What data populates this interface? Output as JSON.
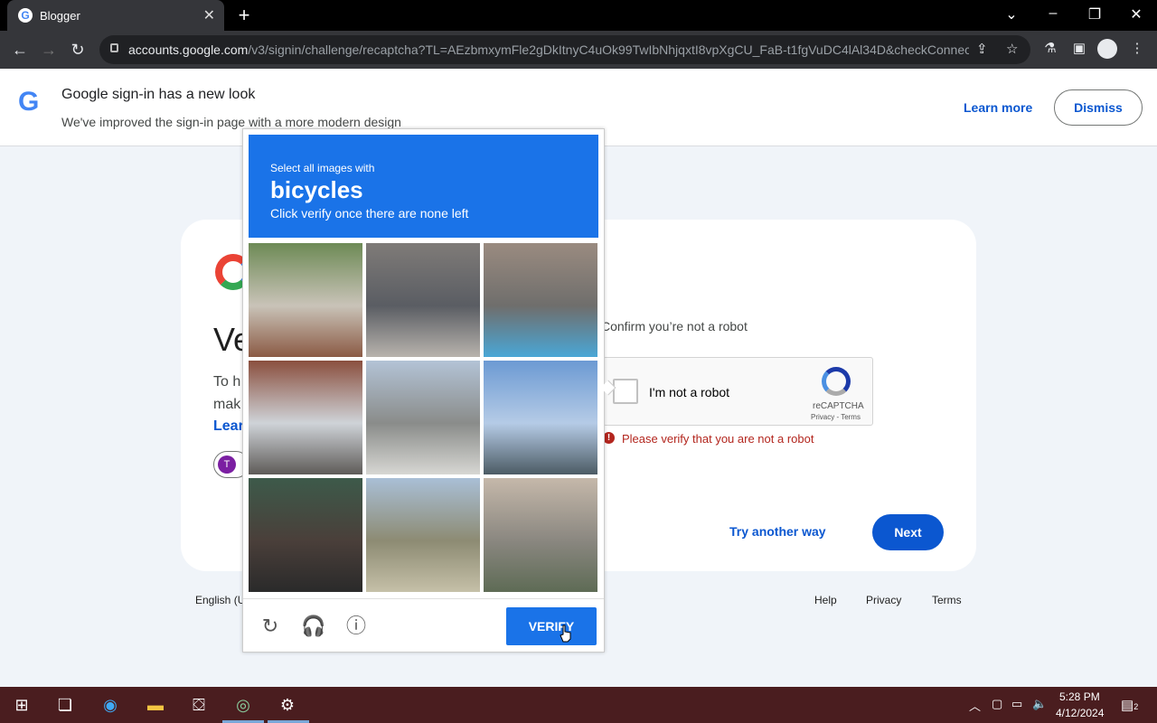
{
  "browser": {
    "tab_title": "Blogger",
    "tab_favicon": "G",
    "url_host": "accounts.google.com",
    "url_path": "/v3/signin/challenge/recaptcha?TL=AEzbmxymFle2gDkItnyC4uOk99TwIbNhjqxtI8vpXgCU_FaB-t1fgVuDC4lAl34D&checkConnec..."
  },
  "banner": {
    "logo": "G",
    "title": "Google sign-in has a new look",
    "subtitle": "We've improved the sign-in page with a more modern design",
    "learn_more": "Learn more",
    "dismiss": "Dismiss"
  },
  "card": {
    "heading_partial": "Ve",
    "line1_partial": "To h",
    "line2_partial": "mak",
    "learn_partial": "Lear",
    "avatar_letter": "T",
    "confirm_text": "Confirm you’re not a robot",
    "checkbox_label": "I'm not a robot",
    "recaptcha_name": "reCAPTCHA",
    "recaptcha_terms": "Privacy - Terms",
    "error_icon": "!",
    "error_text": "Please verify that you are not a robot",
    "try_another": "Try another way",
    "next": "Next"
  },
  "footer": {
    "language": "English (U",
    "help": "Help",
    "privacy": "Privacy",
    "terms": "Terms"
  },
  "challenge": {
    "instruction_pre": "Select all images with",
    "target_word": "bicycles",
    "instruction_post": "Click verify once there are none left",
    "tiles": [
      {
        "name": "tile-plants-fence",
        "colors": [
          "#6d8a55",
          "#c9c3b8",
          "#8b5a44"
        ]
      },
      {
        "name": "tile-building-cars",
        "colors": [
          "#7f7b78",
          "#5a5d63",
          "#b8b3ad"
        ]
      },
      {
        "name": "tile-bike-lane",
        "colors": [
          "#9a8b80",
          "#6f6e6c",
          "#4aa6d6"
        ]
      },
      {
        "name": "tile-bus",
        "colors": [
          "#8a4f3e",
          "#cfd3d8",
          "#5e5b58"
        ]
      },
      {
        "name": "tile-street-trees",
        "colors": [
          "#b3c3d6",
          "#8a8c8a",
          "#d7d7d3"
        ]
      },
      {
        "name": "tile-billboard",
        "colors": [
          "#6c9ad3",
          "#b5cbe6",
          "#4c5b64"
        ]
      },
      {
        "name": "tile-gate",
        "colors": [
          "#3d5a4a",
          "#4a3f3a",
          "#2a2a2a"
        ]
      },
      {
        "name": "tile-roadside-grass",
        "colors": [
          "#a9bfd6",
          "#8d8b73",
          "#c5c0a8"
        ]
      },
      {
        "name": "tile-sidewalk-rail",
        "colors": [
          "#c5b8aa",
          "#8a8780",
          "#5e6b55"
        ]
      }
    ],
    "verify": "VERIFY",
    "icons": {
      "reload": "reload-icon",
      "audio": "headphones-icon",
      "info": "info-icon"
    }
  },
  "taskbar": {
    "time": "5:28 PM",
    "date": "4/12/2024",
    "notification_count": "2"
  }
}
